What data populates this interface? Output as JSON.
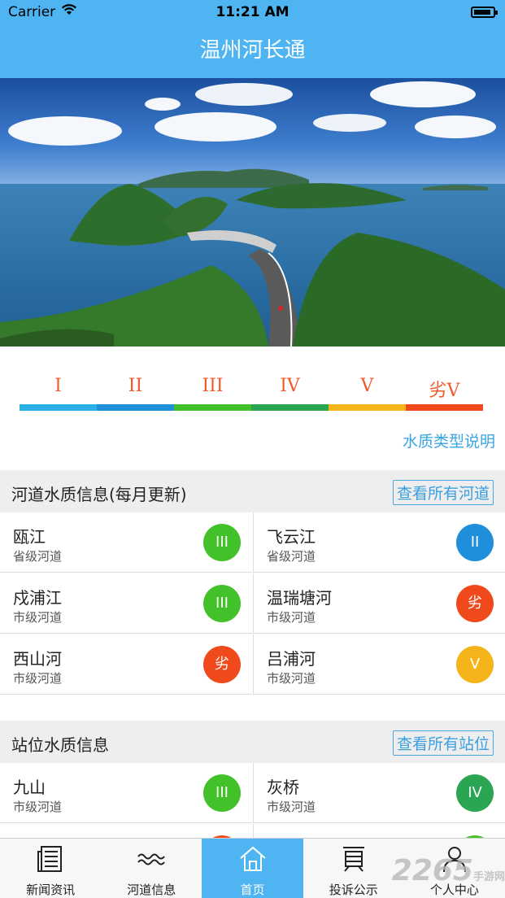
{
  "status": {
    "carrier": "Carrier",
    "time": "11:21 AM"
  },
  "header": {
    "title": "温州河长通"
  },
  "grade_legend": {
    "grades": [
      {
        "label": "I",
        "color": "#2ab0e4"
      },
      {
        "label": "II",
        "color": "#1f8fdc"
      },
      {
        "label": "III",
        "color": "#43c12a"
      },
      {
        "label": "IV",
        "color": "#2aa653"
      },
      {
        "label": "V",
        "color": "#f4b41a"
      },
      {
        "label": "劣V",
        "color": "#f04a1c"
      }
    ],
    "link": "水质类型说明"
  },
  "rivers": {
    "title": "河道水质信息(每月更新)",
    "more": "查看所有河道",
    "items": [
      {
        "name": "瓯江",
        "level": "省级河道",
        "grade": "III",
        "color": "#43c12a"
      },
      {
        "name": "飞云江",
        "level": "省级河道",
        "grade": "II",
        "color": "#1f8fdc"
      },
      {
        "name": "戍浦江",
        "level": "市级河道",
        "grade": "III",
        "color": "#43c12a"
      },
      {
        "name": "温瑞塘河",
        "level": "市级河道",
        "grade": "劣",
        "color": "#f04a1c"
      },
      {
        "name": "西山河",
        "level": "市级河道",
        "grade": "劣",
        "color": "#f04a1c"
      },
      {
        "name": "吕浦河",
        "level": "市级河道",
        "grade": "V",
        "color": "#f4b41a"
      }
    ]
  },
  "stations": {
    "title": "站位水质信息",
    "more": "查看所有站位",
    "items": [
      {
        "name": "九山",
        "level": "市级河道",
        "grade": "III",
        "color": "#43c12a"
      },
      {
        "name": "灰桥",
        "level": "市级河道",
        "grade": "IV",
        "color": "#2aa653"
      }
    ]
  },
  "tabs": [
    {
      "label": "新闻资讯",
      "icon": "newspaper-icon"
    },
    {
      "label": "河道信息",
      "icon": "waves-icon"
    },
    {
      "label": "首页",
      "icon": "home-icon"
    },
    {
      "label": "投诉公示",
      "icon": "notice-icon"
    },
    {
      "label": "个人中心",
      "icon": "person-icon"
    }
  ],
  "active_tab": "首页",
  "watermark": {
    "text": "2265",
    "sub": "手游网",
    "url": ".com"
  }
}
